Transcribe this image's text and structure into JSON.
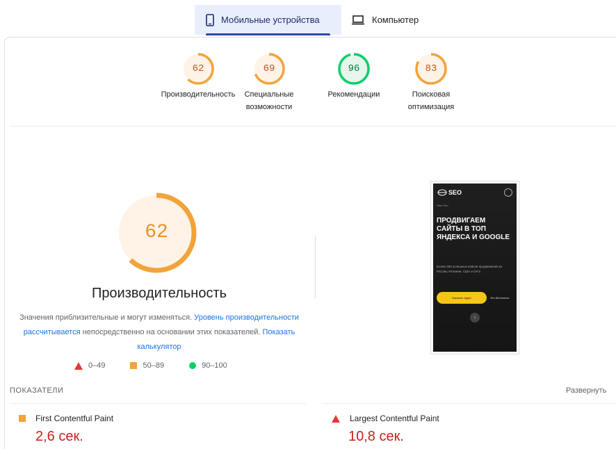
{
  "tabs": [
    {
      "label": "Мобильные устройства",
      "icon": "smartphone-icon",
      "active": true
    },
    {
      "label": "Компьютер",
      "icon": "laptop-icon",
      "active": false
    }
  ],
  "categories": [
    {
      "score": "62",
      "label_lines": [
        "Производительность"
      ],
      "status": "average",
      "color": "#e8922a"
    },
    {
      "score": "69",
      "label_lines": [
        "Специальные",
        "возможности"
      ],
      "status": "average",
      "color": "#e8922a"
    },
    {
      "score": "96",
      "label_lines": [
        "Рекомендации"
      ],
      "status": "pass",
      "color": "#0b8a3a"
    },
    {
      "score": "83",
      "label_lines": [
        "Поисковая",
        "оптимизация"
      ],
      "status": "average",
      "color": "#e8922a"
    }
  ],
  "performance": {
    "score": "62",
    "title": "Производительность",
    "desc_part1": "Значения приблизительные и могут изменяться. ",
    "desc_link1": "Уровень производительности рассчитывается",
    "desc_part2": " непосредственно на основании этих показателей. ",
    "desc_link2": "Показать калькулятор"
  },
  "legend": [
    {
      "range": "0–49",
      "shape": "triangle",
      "color": "#e53935"
    },
    {
      "range": "50–89",
      "shape": "square",
      "color": "#f2a33a"
    },
    {
      "range": "90–100",
      "shape": "circle",
      "color": "#0cce6b"
    }
  ],
  "screenshot": {
    "logo_text": "SEO",
    "small_text": "Наш Seo",
    "headline": "ПРОДВИГАЕМ САЙТЫ В ТОП ЯНДЕКСА И GOOGLE",
    "subtext": "Более 300 успешных кейсов продвижения из России, Испании, США и ОАЭ",
    "button": "Заказать аудит",
    "button2": "Это бесплатно",
    "arrow": "↓"
  },
  "metrics": {
    "heading": "ПОКАЗАТЕЛИ",
    "expand_label": "Развернуть",
    "items": [
      {
        "name": "First Contentful Paint",
        "value": "2,6 сек.",
        "status": "average"
      },
      {
        "name": "Largest Contentful Paint",
        "value": "10,8 сек.",
        "status": "fail"
      }
    ]
  }
}
